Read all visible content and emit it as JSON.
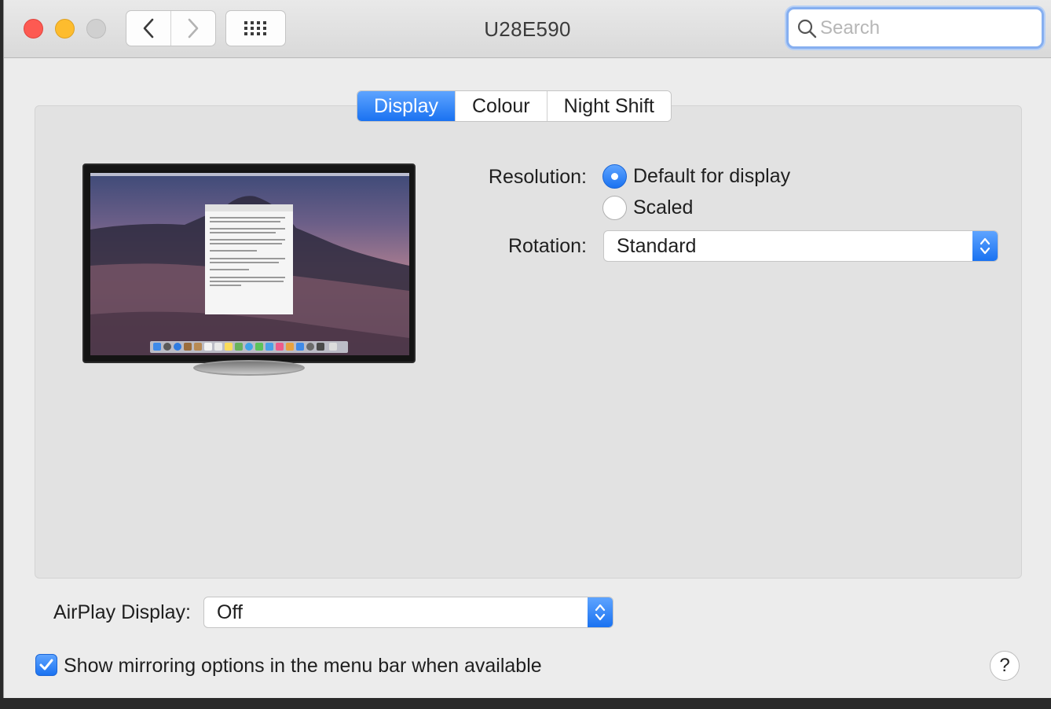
{
  "window": {
    "title": "U28E590"
  },
  "toolbar": {
    "back_icon": "chevron-left-icon",
    "forward_icon": "chevron-right-icon",
    "grid_icon": "grid-icon",
    "search": {
      "placeholder": "Search",
      "icon": "search-icon"
    }
  },
  "tabs": [
    {
      "label": "Display",
      "active": true
    },
    {
      "label": "Colour",
      "active": false
    },
    {
      "label": "Night Shift",
      "active": false
    }
  ],
  "display": {
    "resolution_label": "Resolution:",
    "resolution_options": [
      {
        "label": "Default for display",
        "selected": true
      },
      {
        "label": "Scaled",
        "selected": false
      }
    ],
    "rotation_label": "Rotation:",
    "rotation_value": "Standard"
  },
  "airplay": {
    "label": "AirPlay Display:",
    "value": "Off"
  },
  "mirroring": {
    "label": "Show mirroring options in the menu bar when available",
    "checked": true
  },
  "help": {
    "label": "?"
  },
  "colors": {
    "accent": "#1a72f1",
    "close": "#fd5a52",
    "minimize": "#fdbc2e",
    "zoom_disabled": "#d0d0d0"
  }
}
